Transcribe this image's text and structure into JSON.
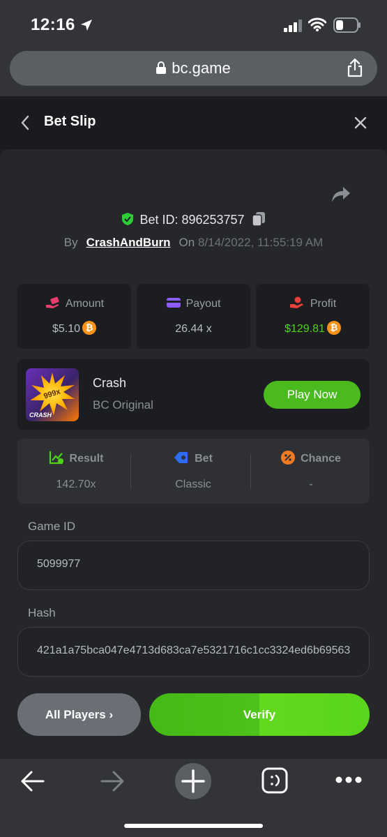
{
  "status_bar": {
    "time": "12:16"
  },
  "browser": {
    "url": "bc.game"
  },
  "slip": {
    "title": "Bet Slip"
  },
  "bet": {
    "id_label": "Bet ID: 896253757",
    "by_label": "By",
    "user": "CrashAndBurn",
    "on_label": "On",
    "date": "8/14/2022, 11:55:19 AM"
  },
  "stats": {
    "amount_label": "Amount",
    "amount_value": "$5.10",
    "payout_label": "Payout",
    "payout_value": "26.44 x",
    "profit_label": "Profit",
    "profit_value": "$129.81"
  },
  "game": {
    "name": "Crash",
    "subtitle": "BC Original",
    "thumb_badge": "999x",
    "thumb_title": "CRASH",
    "play_label": "Play Now"
  },
  "result": {
    "result_label": "Result",
    "result_value": "142.70x",
    "bet_label": "Bet",
    "bet_value": "Classic",
    "chance_label": "Chance",
    "chance_value": "-"
  },
  "fields": {
    "game_id_label": "Game ID",
    "game_id_value": "5099977",
    "hash_label": "Hash",
    "hash_value": "421a1a75bca047e4713d683ca7e5321716c1cc3324ed6b69563"
  },
  "actions": {
    "all_players_label": "All Players",
    "verify_label": "Verify"
  },
  "colors": {
    "accent_green": "#4bba1e",
    "profit_green": "#4fd317",
    "btc_orange": "#f7931a"
  }
}
